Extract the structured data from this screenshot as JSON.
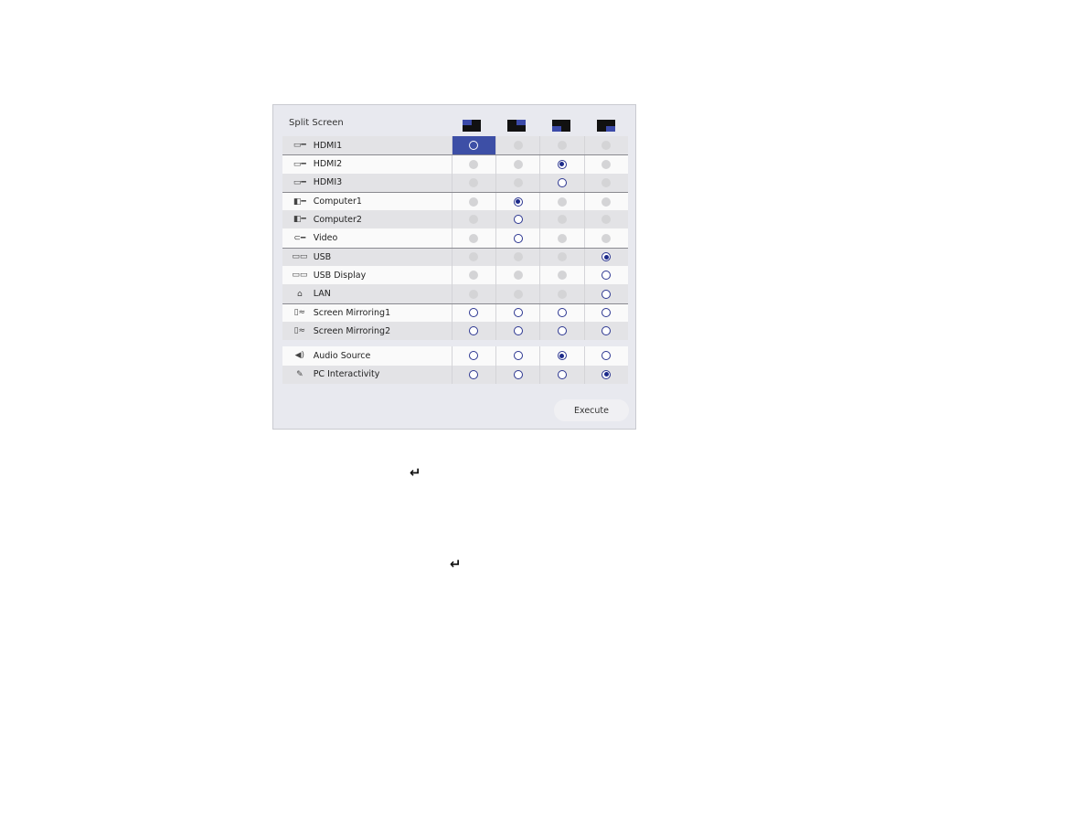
{
  "title": "Split Screen",
  "layouts": [
    "top-left",
    "top-right",
    "bottom-left",
    "bottom-right"
  ],
  "rows": [
    {
      "label": "HDMI1",
      "icon": "hdmi-icon",
      "states": [
        "h",
        "d",
        "d",
        "d"
      ]
    },
    {
      "label": "HDMI2",
      "icon": "hdmi-icon",
      "states": [
        "d",
        "d",
        "s",
        "d"
      ]
    },
    {
      "label": "HDMI3",
      "icon": "hdmi-icon",
      "states": [
        "d",
        "d",
        "o",
        "d"
      ]
    },
    {
      "label": "Computer1",
      "icon": "vga-icon",
      "states": [
        "d",
        "s",
        "d",
        "d"
      ]
    },
    {
      "label": "Computer2",
      "icon": "vga-icon",
      "states": [
        "d",
        "o",
        "d",
        "d"
      ]
    },
    {
      "label": "Video",
      "icon": "rca-icon",
      "states": [
        "d",
        "o",
        "d",
        "d"
      ]
    },
    {
      "label": "USB",
      "icon": "usb-icon",
      "states": [
        "d",
        "d",
        "d",
        "s"
      ]
    },
    {
      "label": "USB Display",
      "icon": "usb-icon",
      "states": [
        "d",
        "d",
        "d",
        "o"
      ]
    },
    {
      "label": "LAN",
      "icon": "lan-icon",
      "states": [
        "d",
        "d",
        "d",
        "o"
      ]
    },
    {
      "label": "Screen Mirroring1",
      "icon": "mirroring-icon",
      "states": [
        "o",
        "o",
        "o",
        "o"
      ]
    },
    {
      "label": "Screen Mirroring2",
      "icon": "mirroring-icon",
      "states": [
        "o",
        "o",
        "o",
        "o"
      ]
    },
    {
      "label": "Audio Source",
      "icon": "speaker-icon",
      "states": [
        "o",
        "o",
        "s",
        "o"
      ]
    },
    {
      "label": "PC Interactivity",
      "icon": "pen-icon",
      "states": [
        "o",
        "o",
        "o",
        "s"
      ]
    }
  ],
  "execute_label": "Execute",
  "enter_symbol": "↵",
  "colors": {
    "accent": "#3d4fa6",
    "selected": "#1c2a8a"
  }
}
